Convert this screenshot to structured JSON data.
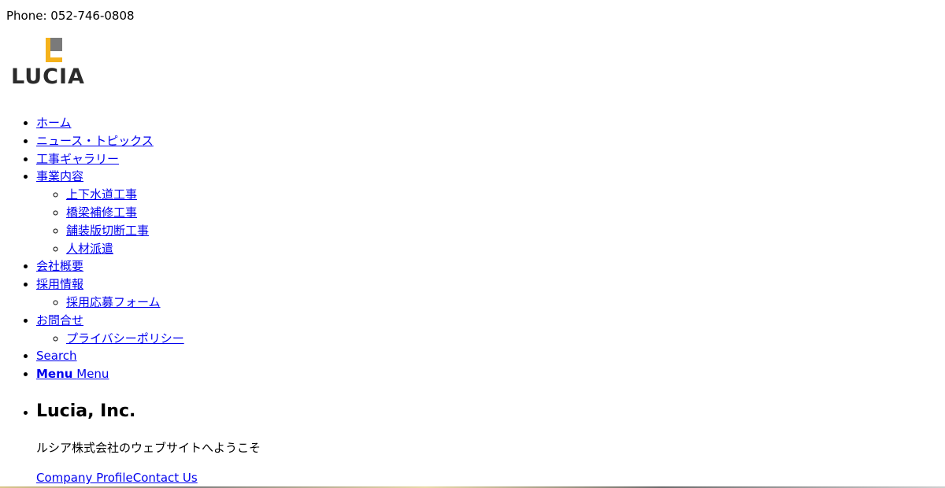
{
  "header": {
    "phone": "Phone: 052-746-0808",
    "logo": {
      "text": "LUCIA",
      "accent_color": "#f5b21b",
      "gray_color": "#7a7a7a",
      "text_color": "#2b2b2b"
    }
  },
  "nav": {
    "items": [
      {
        "label": "ホーム"
      },
      {
        "label": "ニュース・トピックス"
      },
      {
        "label": "工事ギャラリー"
      },
      {
        "label": "事業内容",
        "children": [
          "上下水道工事",
          "橋梁補修工事",
          "舗装版切断工事",
          "人材派遣"
        ]
      },
      {
        "label": "会社概要"
      },
      {
        "label": "採用情報",
        "children": [
          "採用応募フォーム"
        ]
      },
      {
        "label": "お問合せ",
        "children": [
          "プライバシーポリシー"
        ]
      },
      {
        "label": "Search"
      }
    ],
    "menu_toggle": {
      "bold": "Menu",
      "plain": "Menu"
    }
  },
  "hero": {
    "title": "Lucia, Inc.",
    "subtitle": "ルシア株式会社のウェブサイトへようこそ",
    "links": [
      "Company Profile",
      "Contact Us"
    ]
  }
}
